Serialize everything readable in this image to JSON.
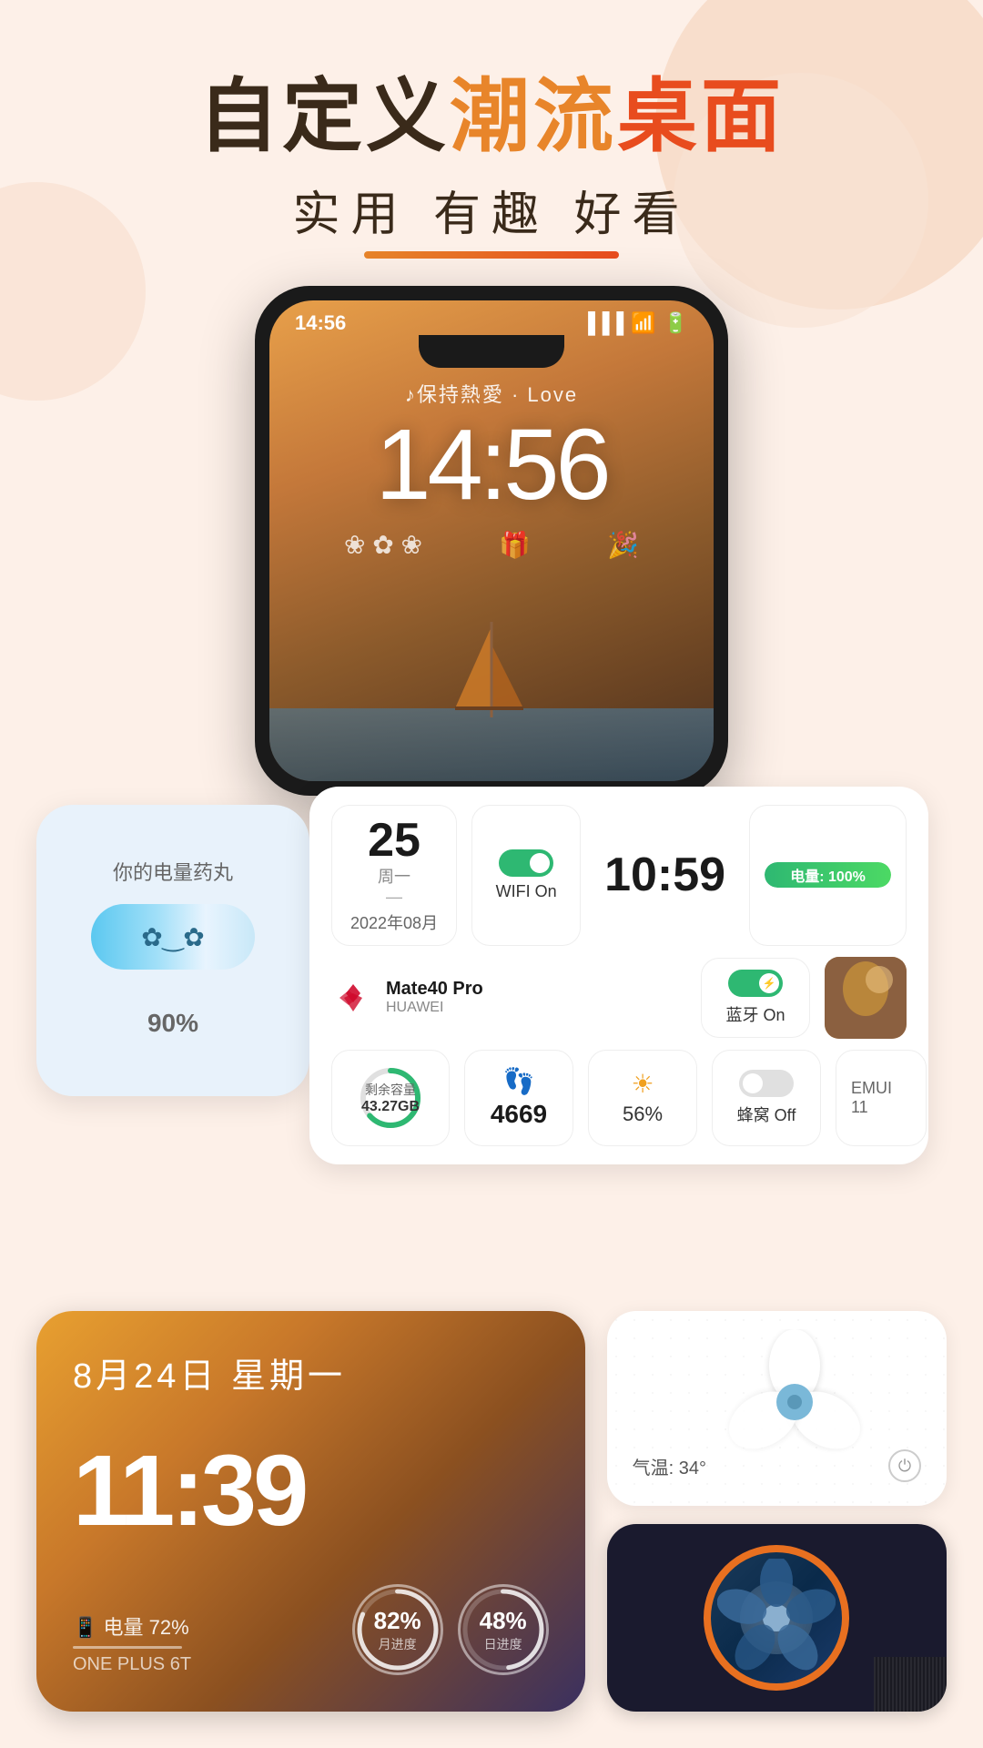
{
  "header": {
    "title_part1": "自定义",
    "title_part2": "潮流",
    "title_part3": "桌面",
    "subtitle": "实用  有趣  好看"
  },
  "phone": {
    "time_small": "14:56",
    "lyrics": "♪保持熱愛 · Love",
    "clock": "14:56"
  },
  "battery_pill_widget": {
    "label": "你的电量药丸",
    "percent": "90",
    "unit": "%"
  },
  "info_widget": {
    "date_day": "25",
    "date_weekday": "周一",
    "date_dash": "—",
    "date_month": "2022年08月",
    "wifi_label": "WIFI On",
    "time": "10:59",
    "battery_label": "电量: 100%",
    "device_model": "Mate40 Pro",
    "device_brand": "HUAWEI",
    "bluetooth_label": "蓝牙 On",
    "storage_label": "剩余容量",
    "storage_gb": "43.27GB",
    "steps": "4669",
    "brightness": "56%",
    "cellular_label": "蜂窝 Off",
    "emui": "EMUI 11"
  },
  "datetime_widget": {
    "date": "8月24日  星期一",
    "time": "11:39",
    "battery": "电量 72%",
    "device": "ONE PLUS 6T",
    "circle1_val": "82%",
    "circle1_label": "月进度",
    "circle2_val": "48%",
    "circle2_label": "日进度"
  },
  "fan_widget": {
    "temp": "气温: 34°",
    "power_icon": "⏻"
  }
}
